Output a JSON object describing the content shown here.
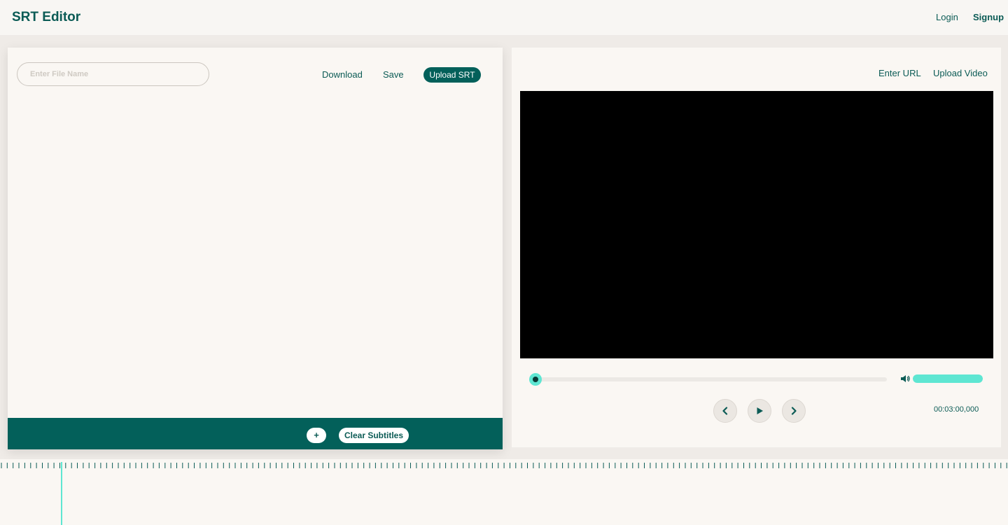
{
  "header": {
    "title": "SRT Editor",
    "login_label": "Login",
    "signup_label": "Signup"
  },
  "editor": {
    "file_name": {
      "value": "",
      "placeholder": "Enter File Name"
    },
    "download_label": "Download",
    "save_label": "Save",
    "upload_srt_label": "Upload SRT",
    "subtitles": [],
    "footer": {
      "add_label": "+",
      "clear_label": "Clear Subtitles"
    }
  },
  "player": {
    "enter_url_label": "Enter URL",
    "upload_video_label": "Upload Video",
    "progress_fraction": 0,
    "volume_fraction": 1,
    "time": "00:03:00,000",
    "icons": [
      "volume-icon",
      "chevron-left-icon",
      "play-icon",
      "chevron-right-icon"
    ]
  },
  "timeline": {
    "playhead_fraction": 0.0604
  },
  "colors": {
    "brand": "#03605a",
    "accent": "#5ee6d2",
    "panel": "#faf7f3",
    "background": "#efebe7",
    "video": "#000000"
  }
}
